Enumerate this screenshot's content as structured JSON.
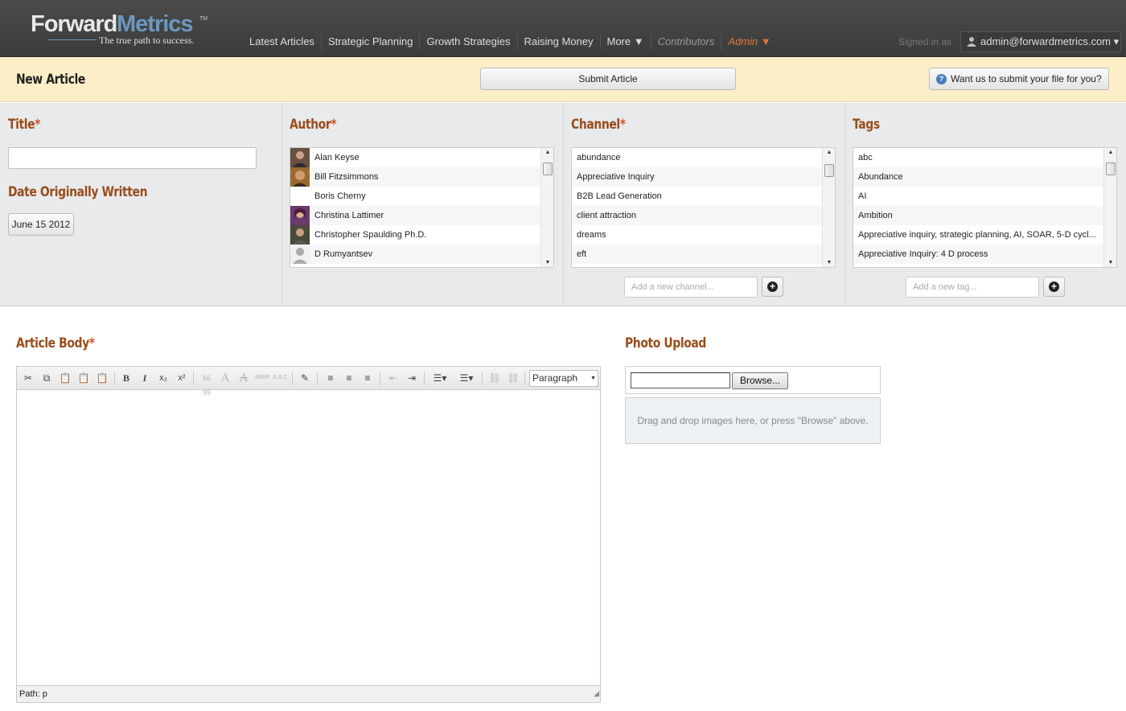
{
  "header": {
    "logo_forward": "Forward",
    "logo_metrics": "Metrics",
    "logo_tm": "TM",
    "logo_tagline": "The true path to success.",
    "nav": [
      {
        "label": "Latest Articles"
      },
      {
        "label": "Strategic Planning"
      },
      {
        "label": "Growth Strategies"
      },
      {
        "label": "Raising Money"
      },
      {
        "label": "More ▼"
      },
      {
        "label": "Contributors"
      },
      {
        "label": "Admin ▼"
      }
    ],
    "signed_in_label": "Signed in as",
    "user_label": "admin@forwardmetrics.com ▾"
  },
  "subbar": {
    "page_title": "New Article",
    "submit_label": "Submit Article",
    "help_label": "Want us to submit your file for you?"
  },
  "form": {
    "title_label": "Title",
    "title_value": "",
    "date_label": "Date Originally Written",
    "date_value": "June 15 2012",
    "author_label": "Author",
    "authors": [
      {
        "name": "Alan Keyse"
      },
      {
        "name": "Bill Fitzsimmons"
      },
      {
        "name": "Boris Cherny"
      },
      {
        "name": "Christina Lattimer"
      },
      {
        "name": "Christopher Spaulding Ph.D."
      },
      {
        "name": "D Rumyantsev"
      }
    ],
    "channel_label": "Channel",
    "channels": [
      "abundance",
      "Appreciative Inquiry",
      "B2B Lead Generation",
      "client attraction",
      "dreams",
      "eft"
    ],
    "channel_placeholder": "Add a new channel...",
    "tags_label": "Tags",
    "tags": [
      "abc",
      "Abundance",
      "AI",
      "Ambition",
      "Appreciative inquiry, strategic planning, AI, SOAR, 5-D cycl...",
      "Appreciative Inquiry: 4 D process"
    ],
    "tag_placeholder": "Add a new tag...",
    "required_mark": "*"
  },
  "editor": {
    "label": "Article Body",
    "format_value": "Paragraph",
    "path_text": "Path: p"
  },
  "upload": {
    "label": "Photo Upload",
    "browse_label": "Browse...",
    "drop_text": "Drag and drop images here, or press \"Browse\" above."
  },
  "colors": {
    "accent_heading": "#9a4c1a",
    "required": "#d0502a",
    "admin": "#e0763b",
    "subbar_bg": "#fcefc8",
    "logo_blue": "#6b98c0"
  }
}
